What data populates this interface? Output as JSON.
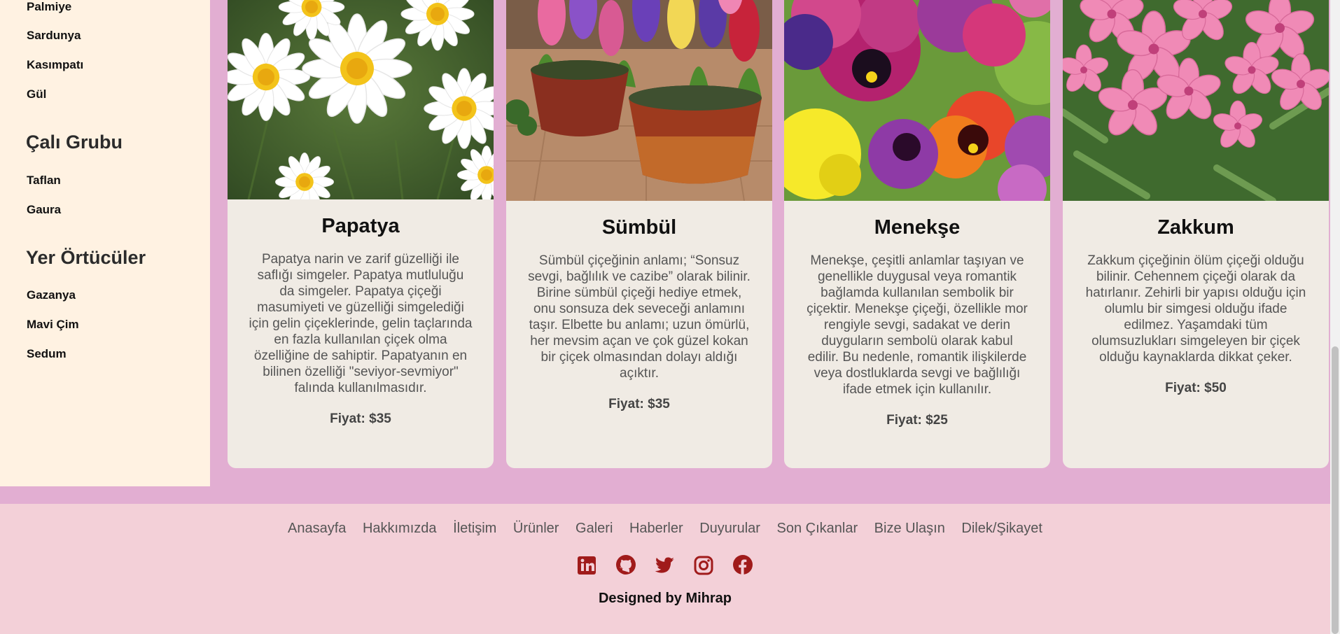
{
  "sidebar": {
    "top_items": [
      "Palmiye",
      "Sardunya",
      "Kasımpatı",
      "Gül"
    ],
    "groups": [
      {
        "title": "Çalı Grubu",
        "items": [
          "Taflan",
          "Gaura"
        ]
      },
      {
        "title": "Yer Örtücüler",
        "items": [
          "Gazanya",
          "Mavi Çim",
          "Sedum"
        ]
      }
    ]
  },
  "cards": [
    {
      "title": "Papatya",
      "text": "Papatya narin ve zarif güzelliği ile saflığı simgeler. Papatya mutluluğu da simgeler. Papatya çiçeği masumiyeti ve güzelliği simgelediği için gelin çiçeklerinde, gelin taçlarında en fazla kullanılan çiçek olma özelliğine de sahiptir. Papatyanın en bilinen özelliği \"seviyor-sevmiyor\" falında kullanılmasıdır.",
      "price": "Fiyat: $35"
    },
    {
      "title": "Sümbül",
      "text": "Sümbül çiçeğinin anlamı; “Sonsuz sevgi, bağlılık ve cazibe” olarak bilinir. Birine sümbül çiçeği hediye etmek, onu sonsuza dek seveceği anlamını taşır. Elbette bu anlamı; uzun ömürlü, her mevsim açan ve çok güzel kokan bir çiçek olmasından dolayı aldığı açıktır.",
      "price": "Fiyat: $35"
    },
    {
      "title": "Menekşe",
      "text": "Menekşe, çeşitli anlamlar taşıyan ve genellikle duygusal veya romantik bağlamda kullanılan sembolik bir çiçektir. Menekşe çiçeği, özellikle mor rengiyle sevgi, sadakat ve derin duyguların sembolü olarak kabul edilir. Bu nedenle, romantik ilişkilerde veya dostluklarda sevgi ve bağlılığı ifade etmek için kullanılır.",
      "price": "Fiyat: $25"
    },
    {
      "title": "Zakkum",
      "text": "Zakkum çiçeğinin ölüm çiçeği olduğu bilinir. Cehennem çiçeği olarak da hatırlanır. Zehirli bir yapısı olduğu için olumlu bir simgesi olduğu ifade edilmez. Yaşamdaki tüm olumsuzlukları simgeleyen bir çiçek olduğu kaynaklarda dikkat çeker.",
      "price": "Fiyat: $50"
    }
  ],
  "footer": {
    "nav": [
      "Anasayfa",
      "Hakkımızda",
      "İletişim",
      "Ürünler",
      "Galeri",
      "Haberler",
      "Duyurular",
      "Son Çıkanlar",
      "Bize Ulaşın",
      "Dilek/Şikayet"
    ],
    "social_icons": [
      "linkedin-icon",
      "github-icon",
      "twitter-icon",
      "instagram-icon",
      "facebook-icon"
    ],
    "credit": "Designed by Mihrap",
    "icon_color": "#a01b1b"
  }
}
